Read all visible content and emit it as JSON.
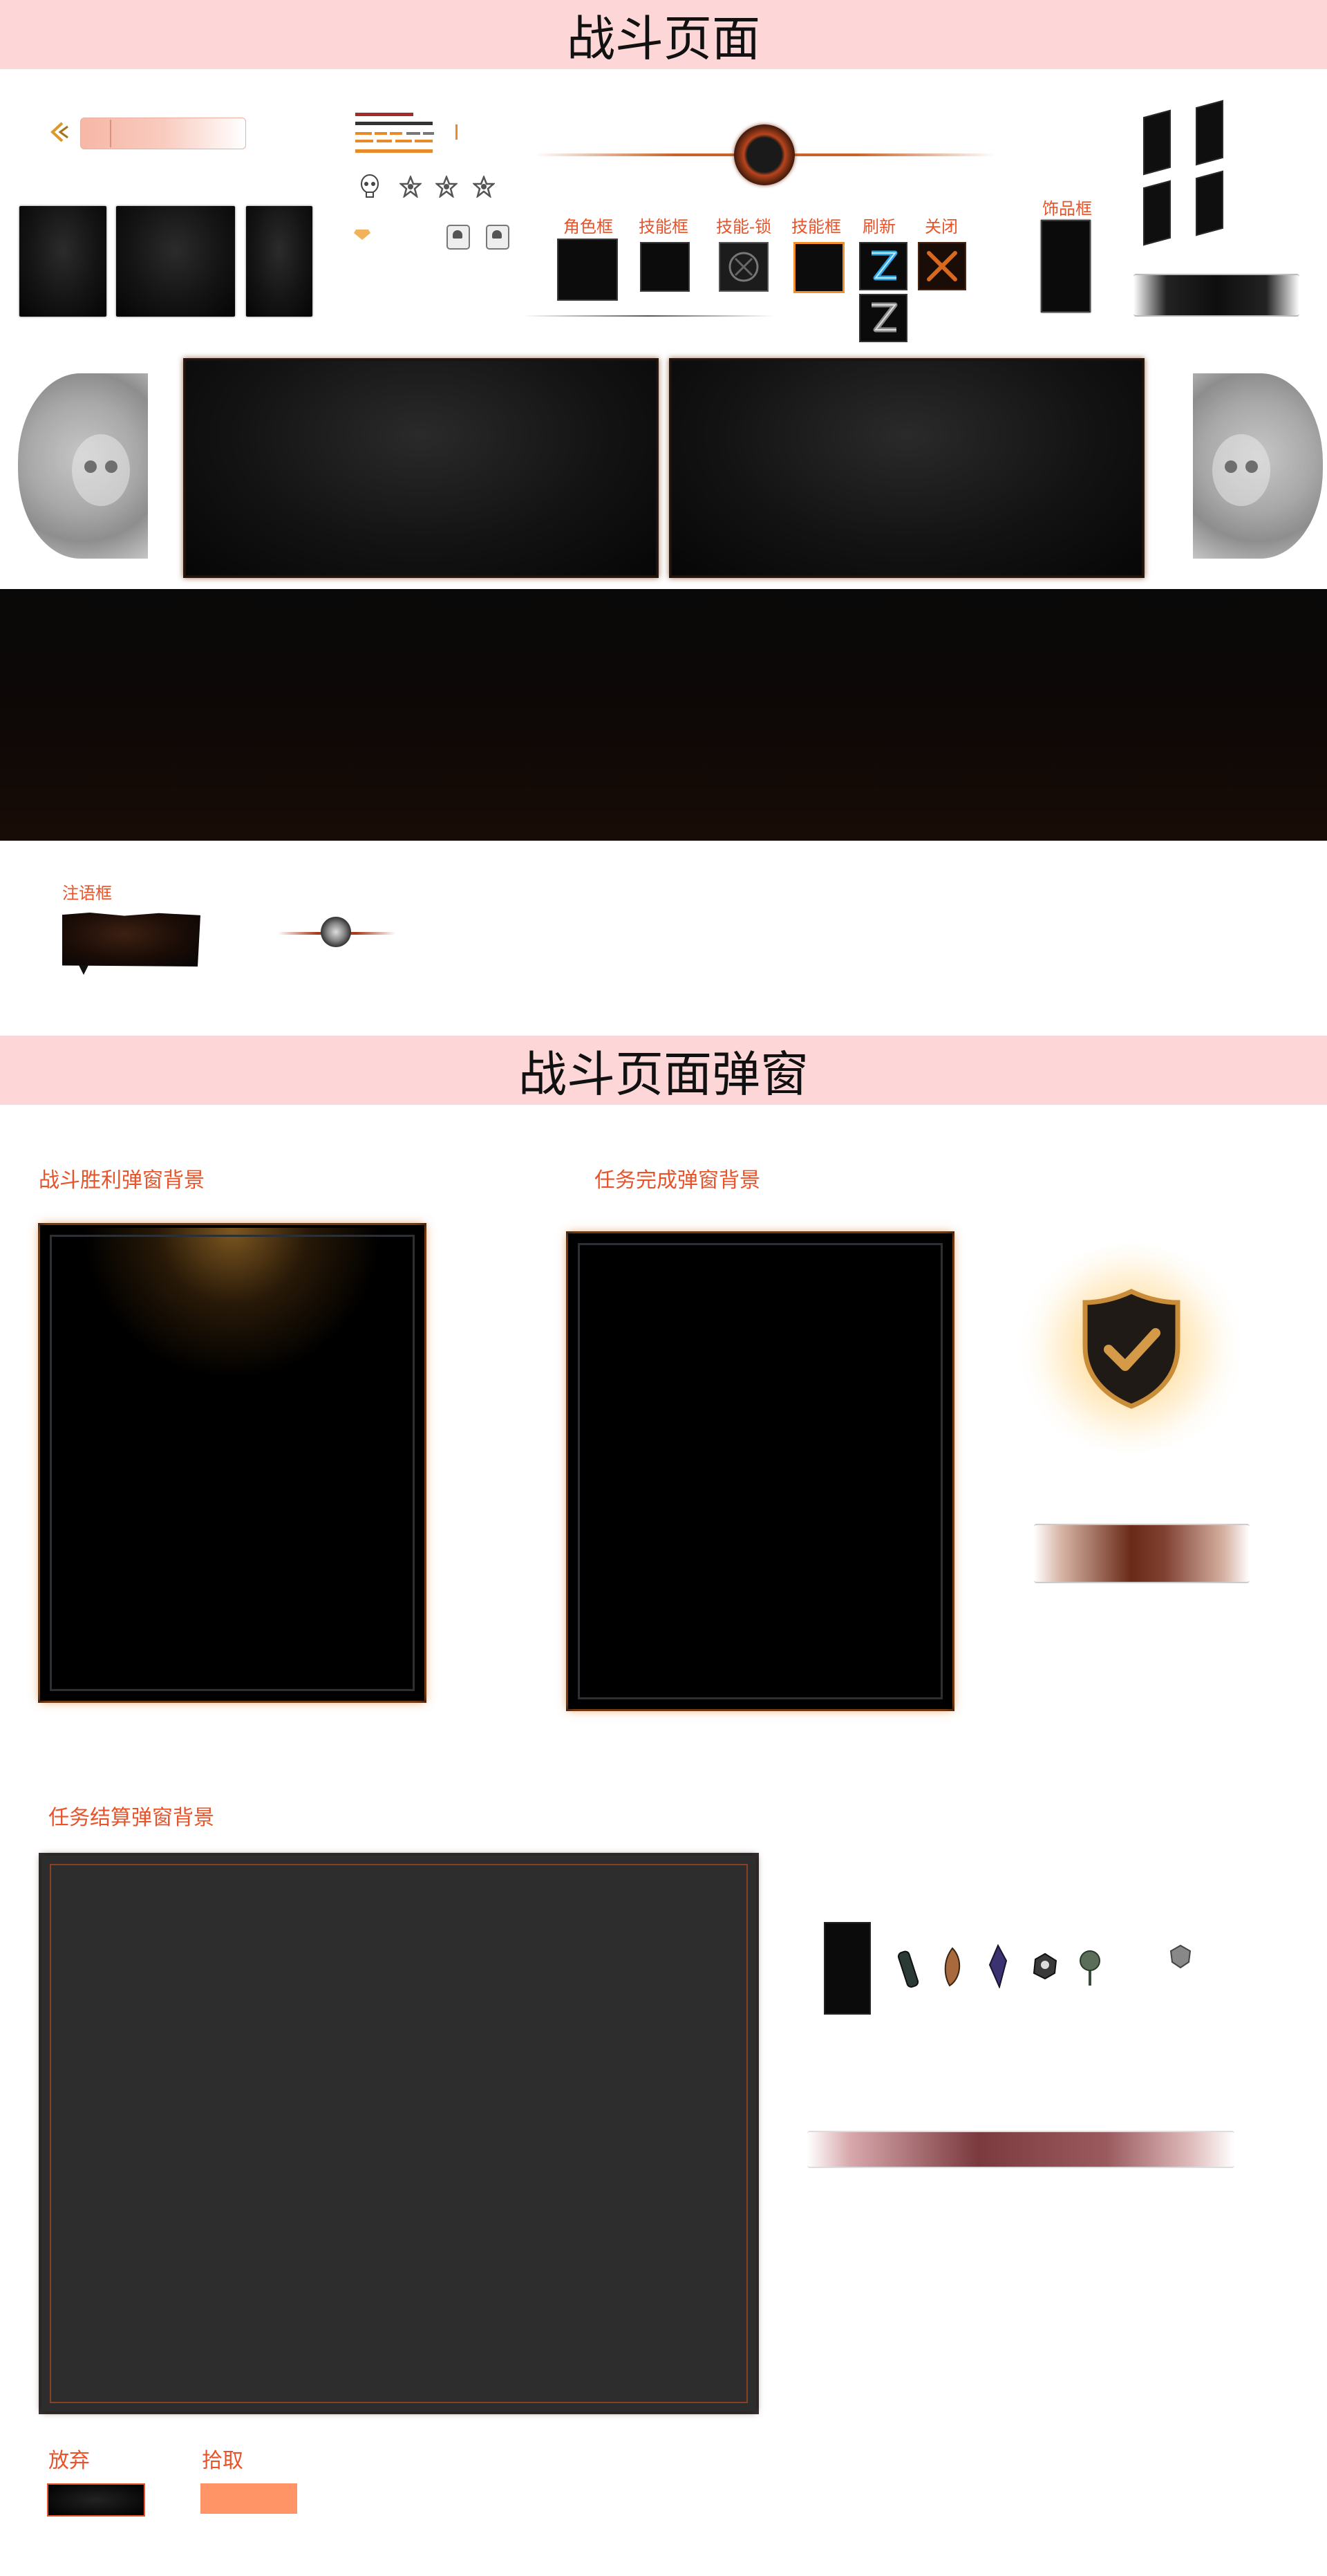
{
  "sections": {
    "battle_page_title": "战斗页面",
    "battle_popup_title": "战斗页面弹窗"
  },
  "battle_page": {
    "skill_labels": {
      "character_frame": "角色框",
      "skill_frame": "技能框",
      "skill_locked": "技能-锁",
      "skill_frame_2": "技能框",
      "refresh": "刷新",
      "close": "关闭"
    },
    "accessory_frame": "饰品框",
    "chant_frame": "注语框"
  },
  "popups": {
    "victory_bg": "战斗胜利弹窗背景",
    "mission_complete_bg": "任务完成弹窗背景",
    "mission_settlement_bg": "任务结算弹窗背景",
    "abandon": "放弃",
    "pickup": "拾取"
  },
  "icons": [
    "back-arrow-icon",
    "skull-icon",
    "pentagram-icon",
    "pentagram-icon",
    "pentagram-icon",
    "gem-icon",
    "mushroom-badge-icon",
    "refresh-lightning-icon",
    "close-cross-icon",
    "shield-check-icon",
    "potion-icon",
    "feather-icon",
    "crystal-icon",
    "ore-icon",
    "herb-icon"
  ],
  "colors": {
    "accent_orange": "#e8532a",
    "banner_pink": "#fdd7d7",
    "pickup_button": "#ff9466",
    "settlement_panel": "#2d2d2d"
  }
}
